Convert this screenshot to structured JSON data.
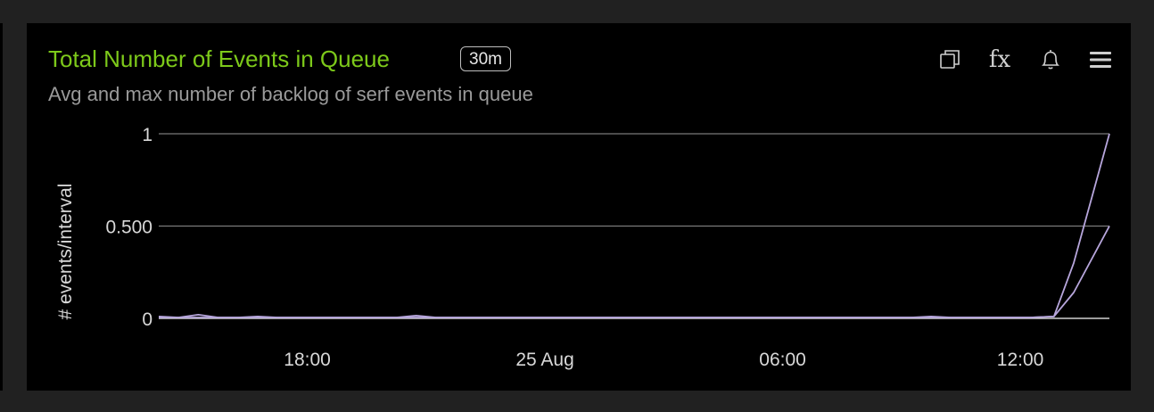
{
  "panel": {
    "title": "Total Number of Events in Queue",
    "time_range": "30m",
    "subtitle": "Avg and max number of backlog of serf events in queue"
  },
  "toolbar": {
    "icons": [
      "copy-icon",
      "fx-icon",
      "bell-icon",
      "menu-icon"
    ],
    "fx_label": "fx"
  },
  "colors": {
    "title": "#7dc91a",
    "series": "#b7a6dc",
    "grid": "#7a7a7a",
    "background": "#000000"
  },
  "chart_data": {
    "type": "line",
    "title": "",
    "xlabel": "",
    "ylabel": "# events/interval",
    "ylim": [
      0,
      1
    ],
    "yticks": [
      0,
      0.5,
      1
    ],
    "ytick_labels": [
      "0",
      "0.500",
      "1"
    ],
    "xlim": [
      "24 Aug 14:15",
      "25 Aug 14:15"
    ],
    "xticks": [
      {
        "label": "18:00",
        "hours": 3.75
      },
      {
        "label": "25 Aug",
        "hours": 9.75
      },
      {
        "label": "06:00",
        "hours": 15.75
      },
      {
        "label": "12:00",
        "hours": 21.75
      }
    ],
    "grid": true,
    "legend": "none",
    "series": [
      {
        "hours": [
          0,
          0.5,
          1.0,
          1.5,
          2.0,
          2.5,
          3.0,
          3.5,
          4.0,
          5.0,
          6.0,
          6.5,
          7.0,
          7.5,
          8.0,
          10.0,
          13.0,
          16.0,
          19.0,
          19.5,
          20.0,
          21.0,
          22.0,
          22.6,
          23.1,
          24.0
        ],
        "values": [
          0.01,
          0.005,
          0.02,
          0.005,
          0.005,
          0.01,
          0.005,
          0.005,
          0.005,
          0.005,
          0.005,
          0.015,
          0.005,
          0.005,
          0.005,
          0.005,
          0.005,
          0.005,
          0.005,
          0.01,
          0.005,
          0.005,
          0.005,
          0.01,
          0.3,
          1.0
        ]
      },
      {
        "hours": [
          0,
          2.0,
          4.0,
          8.0,
          12.0,
          16.0,
          20.0,
          22.0,
          22.6,
          23.1,
          24.0
        ],
        "values": [
          0.005,
          0.005,
          0.005,
          0.005,
          0.005,
          0.005,
          0.005,
          0.005,
          0.01,
          0.14,
          0.5
        ]
      }
    ]
  }
}
